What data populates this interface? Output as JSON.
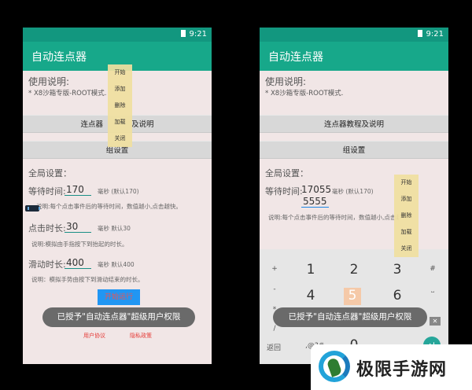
{
  "status": {
    "time": "9:21"
  },
  "app": {
    "title": "自动连点器"
  },
  "usage": {
    "heading": "使用说明:",
    "mode": "* X8沙箱专版-ROOT模式."
  },
  "buttons": {
    "tutorial": "连点器教程及说明",
    "tutorial_left_visible": "连点器",
    "tutorial_right_visible": "及说明",
    "group": "组设置",
    "run": "开始运行"
  },
  "global": {
    "heading": "全局设置："
  },
  "settings": {
    "wait": {
      "label": "等待时间:",
      "value": "170",
      "unit": "毫秒 (默认170)",
      "note": "说明:每个点击事件后的等待时间，数值越小,点击越快。",
      "note_left": "说明:每个点击事件后的等待时间，数值越小,点击越快。"
    },
    "click": {
      "label": "点击时长:",
      "value": "30",
      "unit": "毫秒 默认30",
      "note": "说明:模拟由手指按下到抬起的时长。"
    },
    "slide": {
      "label": "滑动时长:",
      "value": "400",
      "unit": "毫秒 默认400",
      "note": "说明：模拟手势由按下到滑动结束的时长。"
    }
  },
  "menu": [
    "开始",
    "添加",
    "删除",
    "加载",
    "关闭"
  ],
  "toast": "已授予\"自动连点器\"超级用户权限",
  "links": {
    "agreement": "用户协议",
    "privacy": "隐私政策"
  },
  "right": {
    "wait_value": "17055",
    "input_value": "5555",
    "note": "说明:每个点击事件后的等待时间，数值越小,点击越快。"
  },
  "keyboard": {
    "digits": [
      "1",
      "2",
      "3",
      "4",
      "5",
      "6",
      "0"
    ],
    "symbols": [
      "+",
      "-",
      "*",
      "/",
      "#",
      "⎵",
      "返回",
      ",@?#",
      ".",
      "="
    ]
  },
  "watermark": {
    "text": "极限手游网"
  }
}
